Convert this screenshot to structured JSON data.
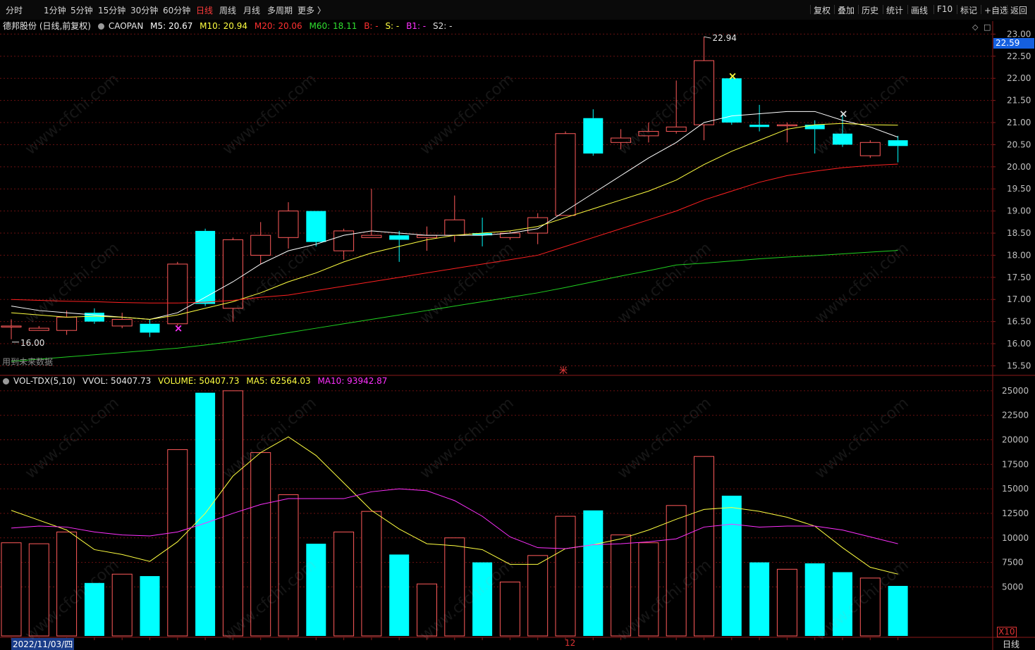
{
  "toolbar": {
    "periods": [
      "分时",
      "1分钟",
      "5分钟",
      "15分钟",
      "30分钟",
      "60分钟",
      "日线",
      "周线",
      "月线",
      "多周期",
      "更多 〉"
    ],
    "active_period": "日线",
    "right_buttons": [
      "复权",
      "叠加",
      "历史",
      "统计",
      "画线",
      "F10",
      "标记",
      "+自选",
      "返回"
    ]
  },
  "legend": {
    "stock": "德邦股份 (日线,前复权)",
    "indicator": "CAOPAN",
    "m5": "M5: 20.67",
    "m10": "M10: 20.94",
    "m20": "M20: 20.06",
    "m60": "M60: 18.11",
    "b": "B: -",
    "s": "S: -",
    "b1": "B1: -",
    "s2": "S2: -"
  },
  "vol_legend": {
    "name": "VOL-TDX(5,10)",
    "vvol": "VVOL: 50407.73",
    "volume": "VOLUME: 50407.73",
    "ma5": "MA5: 62564.03",
    "ma10": "MA10: 93942.87"
  },
  "price_tag": "22.59",
  "max_label": "22.94",
  "min_label": "16.00",
  "unused_note": "用到未来数据",
  "bottom": {
    "date": "2022/11/03/四",
    "month_mark": "12",
    "period": "日线",
    "x10": "X10"
  },
  "colors": {
    "up": "#ff5a5a",
    "down": "#00ffff",
    "m5": "#ffffff",
    "m10": "#ffff40",
    "m20": "#ff2020",
    "m60": "#20d020",
    "ma10vol": "#ff30ff",
    "grid": "#6a1010"
  },
  "watermark_text": "www.cfchi.com",
  "chart_data": [
    {
      "type": "candlestick",
      "title": "德邦股份 (日线,前复权)",
      "ylim": [
        15.3,
        23.15
      ],
      "y_ticks": [
        15.5,
        16.0,
        16.5,
        17.0,
        17.5,
        18.0,
        18.5,
        19.0,
        19.5,
        20.0,
        20.5,
        21.0,
        21.5,
        22.0,
        22.5,
        23.0
      ],
      "candles": [
        {
          "o": 16.4,
          "c": 16.4,
          "h": 16.55,
          "l": 16.1
        },
        {
          "o": 16.3,
          "c": 16.35,
          "h": 16.4,
          "l": 16.3
        },
        {
          "o": 16.3,
          "c": 16.6,
          "h": 16.75,
          "l": 16.2
        },
        {
          "o": 16.7,
          "c": 16.5,
          "h": 16.8,
          "l": 16.45
        },
        {
          "o": 16.4,
          "c": 16.55,
          "h": 16.7,
          "l": 16.35
        },
        {
          "o": 16.45,
          "c": 16.25,
          "h": 16.55,
          "l": 16.15
        },
        {
          "o": 16.45,
          "c": 17.8,
          "h": 17.85,
          "l": 16.4
        },
        {
          "o": 18.55,
          "c": 16.9,
          "h": 18.6,
          "l": 16.85
        },
        {
          "o": 16.8,
          "c": 18.35,
          "h": 18.4,
          "l": 16.5
        },
        {
          "o": 18.0,
          "c": 18.45,
          "h": 18.75,
          "l": 17.8
        },
        {
          "o": 18.4,
          "c": 19.0,
          "h": 19.2,
          "l": 18.15
        },
        {
          "o": 19.0,
          "c": 18.3,
          "h": 19.0,
          "l": 18.2
        },
        {
          "o": 18.1,
          "c": 18.55,
          "h": 18.6,
          "l": 17.9
        },
        {
          "o": 18.4,
          "c": 18.45,
          "h": 19.5,
          "l": 18.4
        },
        {
          "o": 18.45,
          "c": 18.35,
          "h": 18.55,
          "l": 17.85
        },
        {
          "o": 18.4,
          "c": 18.45,
          "h": 18.65,
          "l": 18.1
        },
        {
          "o": 18.45,
          "c": 18.8,
          "h": 19.35,
          "l": 18.3
        },
        {
          "o": 18.5,
          "c": 18.45,
          "h": 18.85,
          "l": 18.2
        },
        {
          "o": 18.4,
          "c": 18.5,
          "h": 18.55,
          "l": 18.35
        },
        {
          "o": 18.5,
          "c": 18.85,
          "h": 18.95,
          "l": 18.25
        },
        {
          "o": 18.9,
          "c": 20.75,
          "h": 20.8,
          "l": 18.9
        },
        {
          "o": 21.1,
          "c": 20.3,
          "h": 21.3,
          "l": 20.25
        },
        {
          "o": 20.55,
          "c": 20.65,
          "h": 20.85,
          "l": 20.4
        },
        {
          "o": 20.7,
          "c": 20.8,
          "h": 21.0,
          "l": 20.55
        },
        {
          "o": 20.8,
          "c": 20.9,
          "h": 21.95,
          "l": 20.75
        },
        {
          "o": 20.95,
          "c": 22.4,
          "h": 22.94,
          "l": 20.6
        },
        {
          "o": 22.0,
          "c": 21.0,
          "h": 22.05,
          "l": 20.95
        },
        {
          "o": 20.95,
          "c": 20.9,
          "h": 21.4,
          "l": 20.8
        },
        {
          "o": 20.95,
          "c": 20.95,
          "h": 21.0,
          "l": 20.55
        },
        {
          "o": 20.95,
          "c": 20.85,
          "h": 21.05,
          "l": 20.3
        },
        {
          "o": 20.75,
          "c": 20.5,
          "h": 21.2,
          "l": 20.45
        },
        {
          "o": 20.25,
          "c": 20.55,
          "h": 20.6,
          "l": 20.2
        },
        {
          "o": 20.6,
          "c": 20.47,
          "h": 20.7,
          "l": 20.1
        }
      ],
      "ma_lines": {
        "M5": [
          16.85,
          16.75,
          16.7,
          16.65,
          16.6,
          16.55,
          16.7,
          17.05,
          17.4,
          17.8,
          18.1,
          18.25,
          18.45,
          18.55,
          18.5,
          18.45,
          18.45,
          18.45,
          18.5,
          18.6,
          19.0,
          19.4,
          19.8,
          20.2,
          20.55,
          21.0,
          21.15,
          21.2,
          21.25,
          21.25,
          21.05,
          20.9,
          20.67
        ],
        "M10": [
          16.7,
          16.65,
          16.6,
          16.62,
          16.6,
          16.55,
          16.65,
          16.8,
          16.95,
          17.15,
          17.4,
          17.6,
          17.85,
          18.05,
          18.2,
          18.35,
          18.45,
          18.5,
          18.55,
          18.65,
          18.85,
          19.05,
          19.25,
          19.45,
          19.7,
          20.05,
          20.35,
          20.6,
          20.85,
          20.95,
          20.98,
          20.95,
          20.94
        ],
        "M20": [
          17.0,
          16.98,
          16.96,
          16.95,
          16.93,
          16.92,
          16.92,
          16.94,
          16.98,
          17.05,
          17.1,
          17.2,
          17.3,
          17.4,
          17.5,
          17.6,
          17.7,
          17.8,
          17.9,
          18.0,
          18.2,
          18.4,
          18.6,
          18.8,
          19.0,
          19.25,
          19.45,
          19.65,
          19.8,
          19.9,
          19.98,
          20.03,
          20.06
        ],
        "M60": [
          15.6,
          15.65,
          15.7,
          15.75,
          15.8,
          15.85,
          15.9,
          15.97,
          16.05,
          16.15,
          16.25,
          16.35,
          16.45,
          16.55,
          16.65,
          16.75,
          16.85,
          16.95,
          17.05,
          17.15,
          17.27,
          17.4,
          17.53,
          17.65,
          17.78,
          17.82,
          17.87,
          17.92,
          17.96,
          17.99,
          18.03,
          18.07,
          18.11
        ]
      },
      "markers": [
        {
          "index": 6,
          "price": 16.35,
          "label": "×",
          "color": "#ff30ff"
        },
        {
          "index": 26,
          "price": 22.05,
          "label": "×",
          "color": "#ffff40"
        },
        {
          "index": 30,
          "price": 21.2,
          "label": "×",
          "color": "#dddddd"
        }
      ]
    },
    {
      "type": "bar",
      "title": "VOL-TDX(5,10)",
      "ylim": [
        0,
        26500
      ],
      "y_ticks": [
        5000,
        7500,
        10000,
        12500,
        15000,
        17500,
        20000,
        22500,
        25000
      ],
      "volumes": [
        9500,
        9400,
        10600,
        5400,
        6300,
        6100,
        19000,
        24800,
        25000,
        18700,
        14400,
        9400,
        10600,
        12700,
        8300,
        5300,
        10000,
        7500,
        5500,
        8200,
        12200,
        12800,
        10300,
        9500,
        13300,
        18300,
        14300,
        7500,
        6800,
        7400,
        6500,
        5900,
        5100
      ],
      "ma5": [
        12800,
        11800,
        10800,
        8800,
        8300,
        7600,
        9600,
        12500,
        16300,
        18700,
        20300,
        18400,
        15600,
        12800,
        10900,
        9400,
        9200,
        8800,
        7300,
        7300,
        8900,
        9300,
        9900,
        10800,
        11900,
        12900,
        13100,
        12700,
        12100,
        11200,
        9000,
        7000,
        6300
      ],
      "ma10": [
        11000,
        11200,
        11100,
        10600,
        10300,
        10200,
        10600,
        11500,
        12500,
        13400,
        14000,
        14000,
        14000,
        14700,
        15000,
        14800,
        13800,
        12200,
        10100,
        9000,
        8900,
        9300,
        9400,
        9600,
        9900,
        11100,
        11400,
        11100,
        11200,
        11200,
        10800,
        10100,
        9400
      ]
    }
  ]
}
